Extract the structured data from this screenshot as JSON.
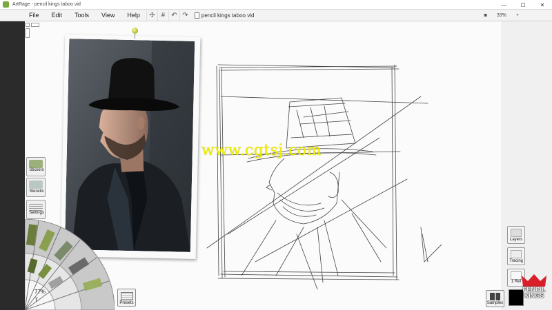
{
  "window": {
    "title": "ArtRage - pencil kings taboo vid",
    "minimize_glyph": "—",
    "maximize_glyph": "☐",
    "close_glyph": "✕"
  },
  "menu": {
    "items": [
      "File",
      "Edit",
      "Tools",
      "View",
      "Help"
    ],
    "document_name": "pencil kings taboo vid",
    "zoom_label": "33%",
    "tool_glyphs": [
      "✢",
      "#",
      "↶",
      "↷"
    ]
  },
  "canvas": {
    "watermark": "www.cgtsj.com",
    "zoom_percent": "77%"
  },
  "left_panels": [
    {
      "label": "Stickers",
      "icon": "stickers-icon"
    },
    {
      "label": "Stencils",
      "icon": "stencils-icon"
    },
    {
      "label": "Settings",
      "icon": "settings-icon"
    }
  ],
  "bottom": {
    "presets_label": "Presets",
    "samples_label": "Samples"
  },
  "right_panels": [
    {
      "label": "Layers",
      "icon": "layers-icon"
    },
    {
      "label": "Tracing",
      "icon": "tracing-icon"
    },
    {
      "label": "1 Ref",
      "icon": "reference-icon"
    }
  ],
  "brand": {
    "line1": "PENCIL",
    "line2": "KINGS"
  },
  "colors": {
    "accent_green": "#7aa83a",
    "watermark_yellow": "#f4f000",
    "brand_red": "#d9202a",
    "current_color": "#000000"
  }
}
